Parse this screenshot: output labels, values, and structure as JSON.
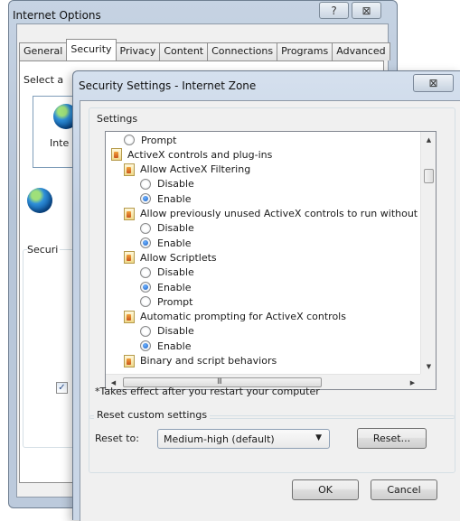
{
  "internet_options": {
    "title": "Internet Options",
    "help_glyph": "?",
    "close_glyph": "⊠",
    "tabs": [
      {
        "label": "General"
      },
      {
        "label": "Security",
        "active": true
      },
      {
        "label": "Privacy"
      },
      {
        "label": "Content"
      },
      {
        "label": "Connections"
      },
      {
        "label": "Programs"
      },
      {
        "label": "Advanced"
      }
    ],
    "select_zone_partial": "Select a",
    "zone_label_partial": "Inte",
    "security_level_partial": "Securi"
  },
  "security_settings": {
    "title": "Security Settings - Internet Zone",
    "close_glyph": "⊠",
    "settings_group_label": "Settings",
    "tree": [
      {
        "kind": "radio",
        "indent": 1,
        "checked": false,
        "label": "Prompt"
      },
      {
        "kind": "category",
        "indent": 0,
        "label": "ActiveX controls and plug-ins"
      },
      {
        "kind": "category",
        "indent": 1,
        "label": "Allow ActiveX Filtering"
      },
      {
        "kind": "radio",
        "indent": 2,
        "checked": false,
        "label": "Disable"
      },
      {
        "kind": "radio",
        "indent": 2,
        "checked": true,
        "label": "Enable"
      },
      {
        "kind": "category",
        "indent": 1,
        "label": "Allow previously unused ActiveX controls to run without prom"
      },
      {
        "kind": "radio",
        "indent": 2,
        "checked": false,
        "label": "Disable"
      },
      {
        "kind": "radio",
        "indent": 2,
        "checked": true,
        "label": "Enable"
      },
      {
        "kind": "category",
        "indent": 1,
        "label": "Allow Scriptlets"
      },
      {
        "kind": "radio",
        "indent": 2,
        "checked": false,
        "label": "Disable"
      },
      {
        "kind": "radio",
        "indent": 2,
        "checked": true,
        "label": "Enable"
      },
      {
        "kind": "radio",
        "indent": 2,
        "checked": false,
        "label": "Prompt"
      },
      {
        "kind": "category",
        "indent": 1,
        "label": "Automatic prompting for ActiveX controls"
      },
      {
        "kind": "radio",
        "indent": 2,
        "checked": false,
        "label": "Disable"
      },
      {
        "kind": "radio",
        "indent": 2,
        "checked": true,
        "label": "Enable"
      },
      {
        "kind": "category",
        "indent": 1,
        "label": "Binary and script behaviors"
      }
    ],
    "scroll": {
      "up": "▲",
      "down": "▼",
      "left": "◀",
      "right": "▶",
      "grip": "III"
    },
    "note": "*Takes effect after you restart your computer",
    "reset_group_label": "Reset custom settings",
    "reset_to_label": "Reset to:",
    "reset_level_value": "Medium-high (default)",
    "combo_arrow": "▼",
    "reset_button": "Reset...",
    "ok_button": "OK",
    "cancel_button": "Cancel"
  }
}
